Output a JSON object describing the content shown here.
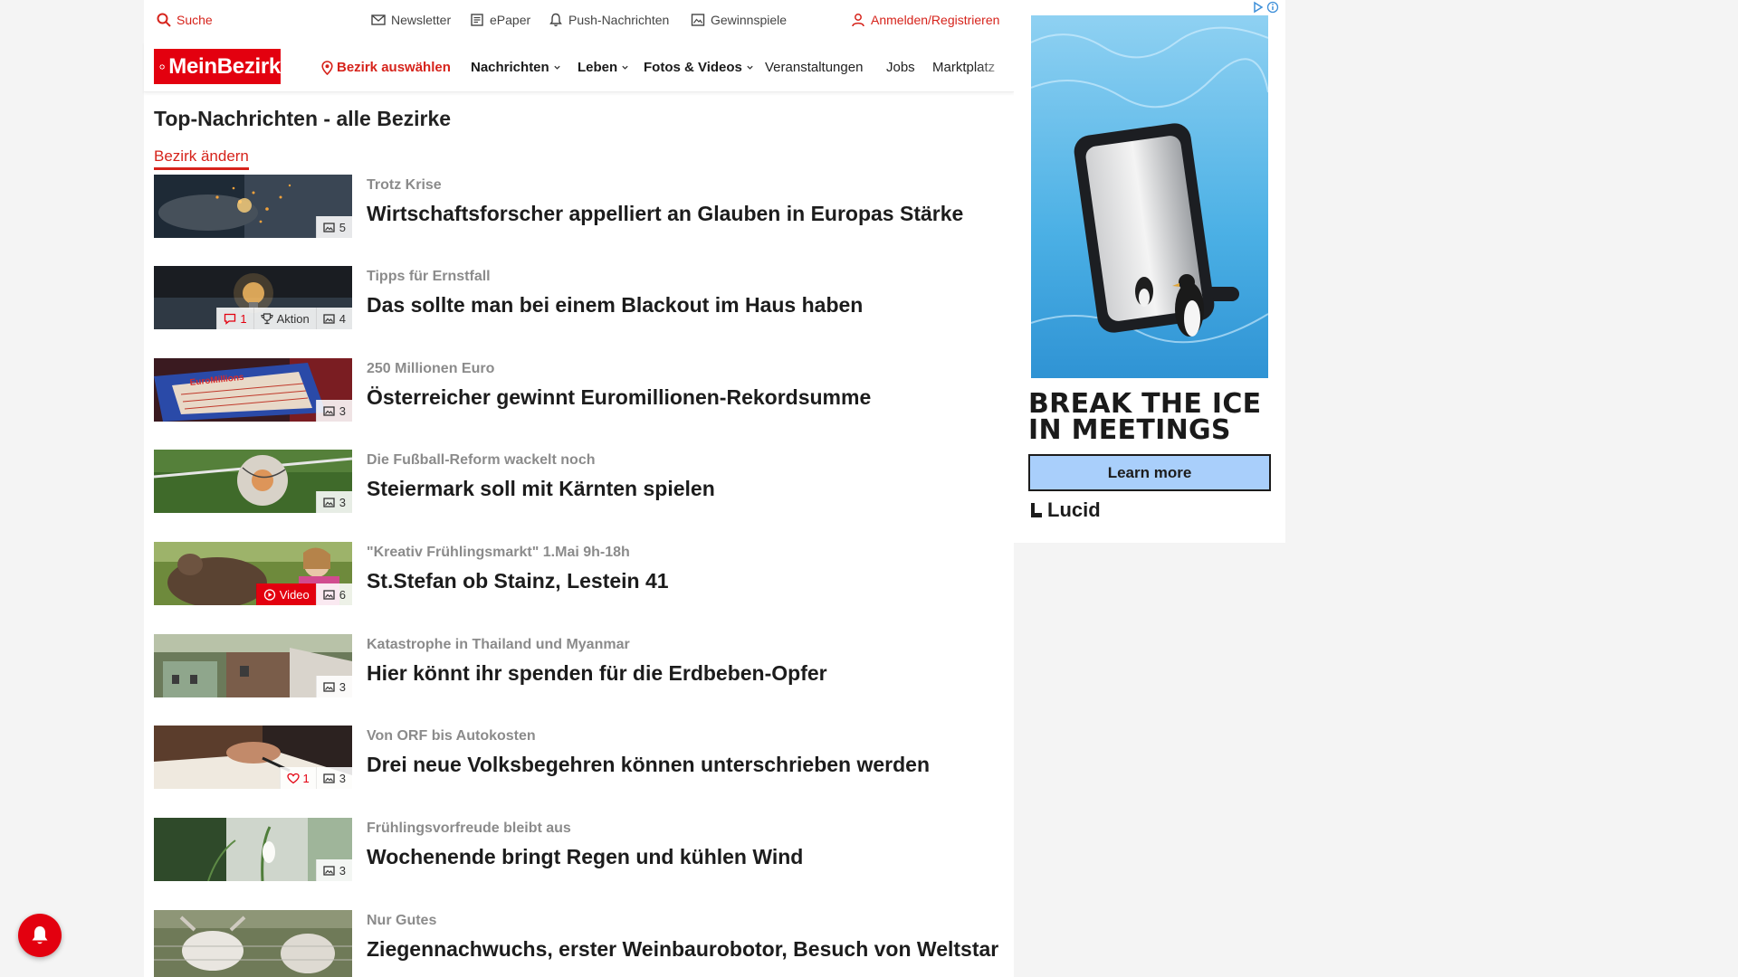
{
  "utility": {
    "search": "Suche",
    "newsletter": "Newsletter",
    "epaper": "ePaper",
    "push": "Push-Nachrichten",
    "games": "Gewinnspiele",
    "login": "Anmelden/Registrieren"
  },
  "nav": {
    "logo": "MeinBezirk",
    "district_select": "Bezirk auswählen",
    "items": [
      "Nachrichten",
      "Leben",
      "Fotos & Videos",
      "Veranstaltungen",
      "Jobs",
      "Marktplatz"
    ]
  },
  "page": {
    "heading": "Top-Nachrichten - alle Bezirke",
    "change_district": "Bezirk ändern"
  },
  "articles": [
    {
      "kicker": "Trotz Krise",
      "headline": "Wirtschaftsforscher appelliert an Glauben in Europas Stärke",
      "photos": "5"
    },
    {
      "kicker": "Tipps für Ernstfall",
      "headline": "Das sollte man bei einem Blackout im Haus haben",
      "comments": "1",
      "action": "Aktion",
      "photos": "4"
    },
    {
      "kicker": "250 Millionen Euro",
      "headline": "Österreicher gewinnt Euromillionen-Rekordsumme",
      "photos": "3"
    },
    {
      "kicker": "Die Fußball-Reform wackelt noch",
      "headline": "Steiermark soll mit Kärnten spielen",
      "photos": "3"
    },
    {
      "kicker": "\"Kreativ Frühlingsmarkt\" 1.Mai 9h-18h",
      "headline": "St.Stefan ob Stainz, Lestein 41",
      "video": "Video",
      "photos": "6"
    },
    {
      "kicker": "Katastrophe in Thailand und Myanmar",
      "headline": "Hier könnt ihr spenden für die Erdbeben-Opfer",
      "photos": "3"
    },
    {
      "kicker": "Von ORF bis Autokosten",
      "headline": "Drei neue Volksbegehren können unterschrieben werden",
      "likes": "1",
      "photos": "3"
    },
    {
      "kicker": "Frühlingsvorfreude bleibt aus",
      "headline": "Wochenende bringt Regen und kühlen Wind",
      "photos": "3"
    },
    {
      "kicker": "Nur Gutes",
      "headline": "Ziegennachwuchs, erster Weinbaurobotor, Besuch von Weltstar"
    }
  ],
  "ad": {
    "headline": "BREAK THE ICE IN MEETINGS",
    "cta": "Learn more",
    "brand": "Lucid"
  },
  "colors": {
    "brand_red": "#e3000f",
    "ad_cta": "#a9cffb"
  }
}
